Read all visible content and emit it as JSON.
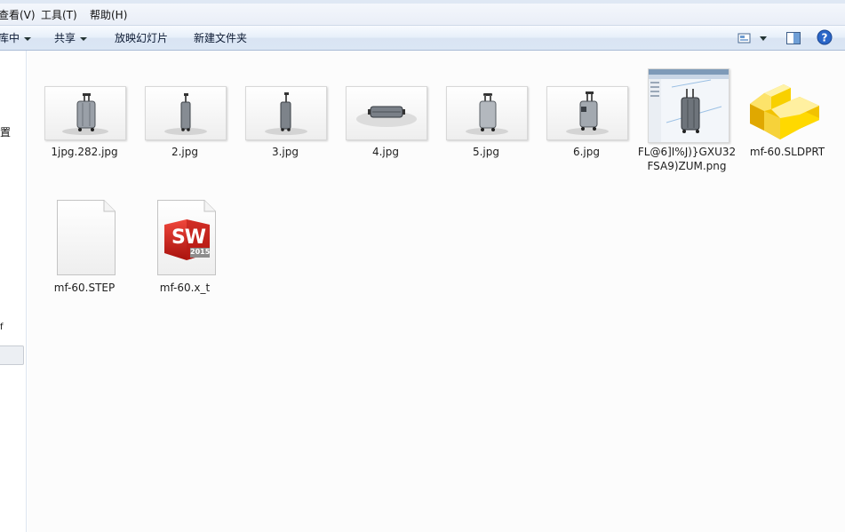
{
  "menubar": {
    "view": "查看(V)",
    "tools": "工具(T)",
    "help": "帮助(H)"
  },
  "toolbar": {
    "include_library": "库中",
    "share": "共享",
    "slideshow": "放映幻灯片",
    "new_folder": "新建文件夹"
  },
  "navpane": {
    "frag_a": "置",
    "frag_b": "f"
  },
  "files": [
    {
      "name": "1jpg.282.jpg",
      "type": "jpg"
    },
    {
      "name": "2.jpg",
      "type": "jpg"
    },
    {
      "name": "3.jpg",
      "type": "jpg"
    },
    {
      "name": "4.jpg",
      "type": "jpg"
    },
    {
      "name": "5.jpg",
      "type": "jpg"
    },
    {
      "name": "6.jpg",
      "type": "jpg"
    },
    {
      "name": "FL@6]I%J)}GXU32FSA9)ZUM.png",
      "type": "png"
    },
    {
      "name": "mf-60.SLDPRT",
      "type": "sldprt"
    },
    {
      "name": "mf-60.STEP",
      "type": "step"
    },
    {
      "name": "mf-60.x_t",
      "type": "x_t",
      "badge": "SW",
      "badge_year": "2015"
    }
  ],
  "colors": {
    "solidworks_red": "#d8221c",
    "sldprt_yellow": "#f2c200",
    "help_blue": "#2a66c8"
  },
  "icons": [
    "view-options-icon",
    "preview-pane-icon",
    "help-icon",
    "generic-file-icon",
    "solidworks-icon",
    "part-icon"
  ]
}
